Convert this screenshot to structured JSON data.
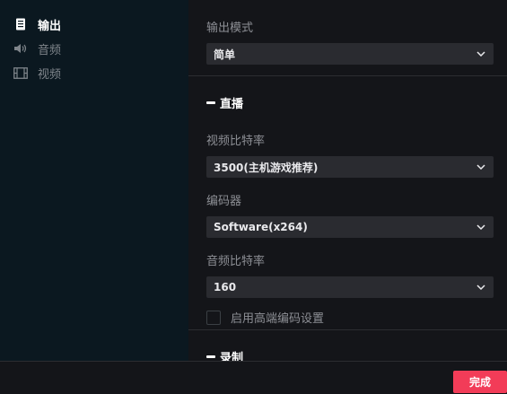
{
  "sidebar": {
    "items": [
      {
        "label": "输出",
        "icon": "document-icon"
      },
      {
        "label": "音频",
        "icon": "speaker-icon"
      },
      {
        "label": "视频",
        "icon": "film-icon"
      }
    ]
  },
  "main": {
    "output_mode_label": "输出模式",
    "output_mode_value": "简单",
    "live": {
      "header": "直播",
      "video_bitrate_label": "视频比特率",
      "video_bitrate_value": "3500(主机游戏推荐)",
      "encoder_label": "编码器",
      "encoder_value": "Software(x264)",
      "audio_bitrate_label": "音频比特率",
      "audio_bitrate_value": "160",
      "advanced_encoder_label": "启用高端编码设置",
      "advanced_encoder_checked": false
    },
    "record": {
      "header": "录制"
    }
  },
  "footer": {
    "done_label": "完成"
  },
  "colors": {
    "accent": "#f23c58",
    "sidebar_bg": "#0b1820",
    "main_bg": "#141519",
    "select_bg": "#2a2b30"
  }
}
